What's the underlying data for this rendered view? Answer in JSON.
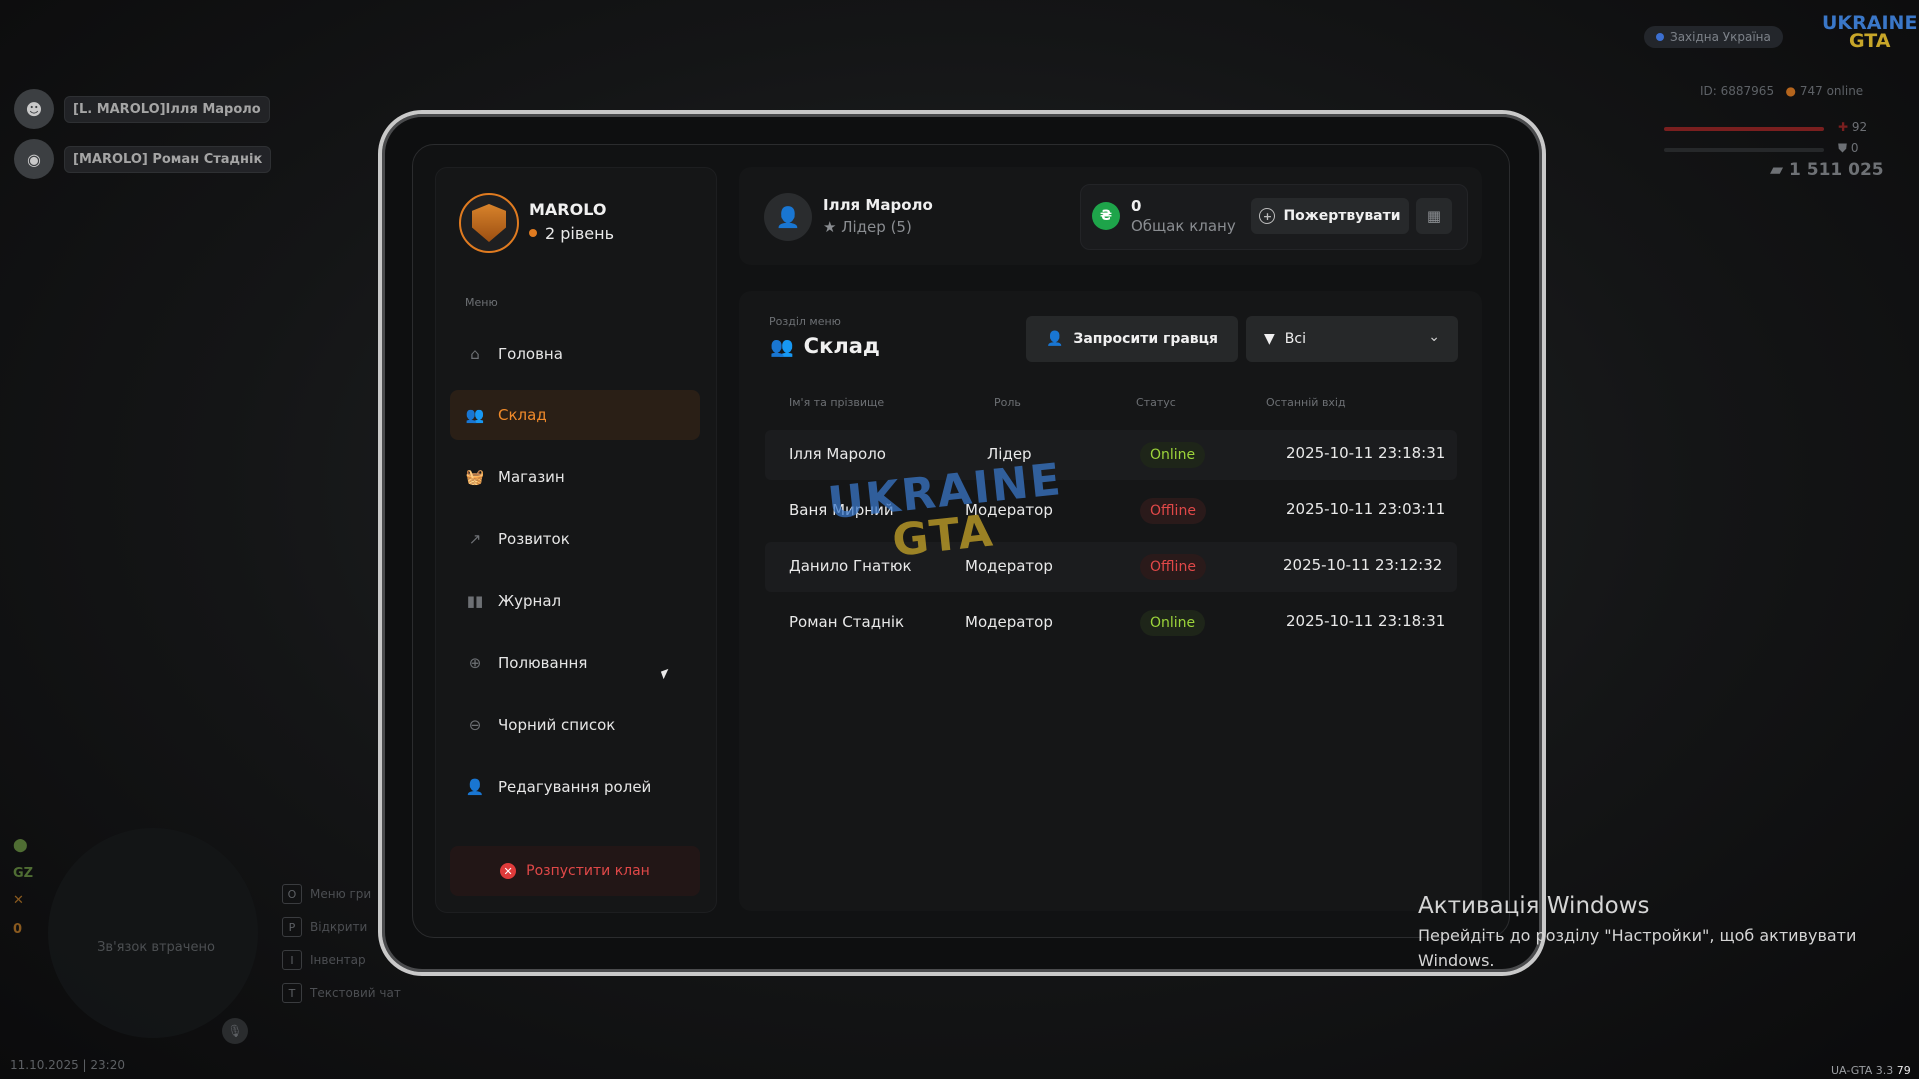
{
  "hud": {
    "players": [
      {
        "name": "[L. MAROLO]Ілля Мароло"
      },
      {
        "name": "[MAROLO] Роман Стаднік"
      }
    ],
    "region": "Західна Україна",
    "server_logo_top": "UKRAINE",
    "server_logo_bottom": "GTA",
    "server_id": "ID: 6887965",
    "online": "747 online",
    "health": "92",
    "armor": "0",
    "money": "1 511 025",
    "side_gz": "GZ",
    "side_zero": "0",
    "minimap_text": "Зв'язок втрачено",
    "key_hints": [
      {
        "key": "O",
        "label": "Меню гри"
      },
      {
        "key": "P",
        "label": "Відкрити"
      },
      {
        "key": "I",
        "label": "Інвентар"
      },
      {
        "key": "T",
        "label": "Текстовий чат"
      }
    ],
    "datetime": "11.10.2025 | 23:20",
    "version": "UA-GTA 3.3",
    "version_num": "79"
  },
  "windows": {
    "activation_title": "Активація Windows",
    "activation_text": "Перейдіть до розділу \"Настройки\", щоб активувати Windows."
  },
  "clan": {
    "name": "MAROLO",
    "level": "2 рівень",
    "accent": "#e07b20"
  },
  "sidebar": {
    "menu_title": "Меню",
    "items": [
      {
        "label": "Головна",
        "icon": "home-icon",
        "active": false
      },
      {
        "label": "Склад",
        "icon": "group-icon",
        "active": true
      },
      {
        "label": "Магазин",
        "icon": "basket-icon",
        "active": false
      },
      {
        "label": "Розвиток",
        "icon": "chart-icon",
        "active": false
      },
      {
        "label": "Журнал",
        "icon": "book-icon",
        "active": false
      },
      {
        "label": "Полювання",
        "icon": "crosshair-icon",
        "active": false
      },
      {
        "label": "Чорний список",
        "icon": "block-icon",
        "active": false
      },
      {
        "label": "Редагування ролей",
        "icon": "user-edit-icon",
        "active": false
      }
    ],
    "disband_label": "Розпустити клан"
  },
  "header": {
    "user_name": "Ілля Мароло",
    "user_role": "Лідер (5)",
    "treasury_value": "0",
    "treasury_label": "Общак клану",
    "coin_symbol": "₴",
    "donate_label": "Пожертвувати"
  },
  "content": {
    "section_small": "Розділ меню",
    "section_title": "Склад",
    "invite_label": "Запросити гравця",
    "filter_value": "Всі",
    "columns": [
      "Ім'я та прізвище",
      "Роль",
      "Статус",
      "Останній вхід"
    ],
    "rows": [
      {
        "name": "Ілля Мароло",
        "role": "Лідер",
        "status": "Online",
        "last": "2025-10-11 23:18:31"
      },
      {
        "name": "Ваня Мирний",
        "role": "Модератор",
        "status": "Offline",
        "last": "2025-10-11 23:03:11"
      },
      {
        "name": "Данило Гнатюк",
        "role": "Модератор",
        "status": "Offline",
        "last": "2025-10-11 23:12:32"
      },
      {
        "name": "Роман Стаднік",
        "role": "Модератор",
        "status": "Online",
        "last": "2025-10-11 23:18:31"
      }
    ],
    "watermark_top": "UKRAINE",
    "watermark_bottom": "GTA"
  }
}
